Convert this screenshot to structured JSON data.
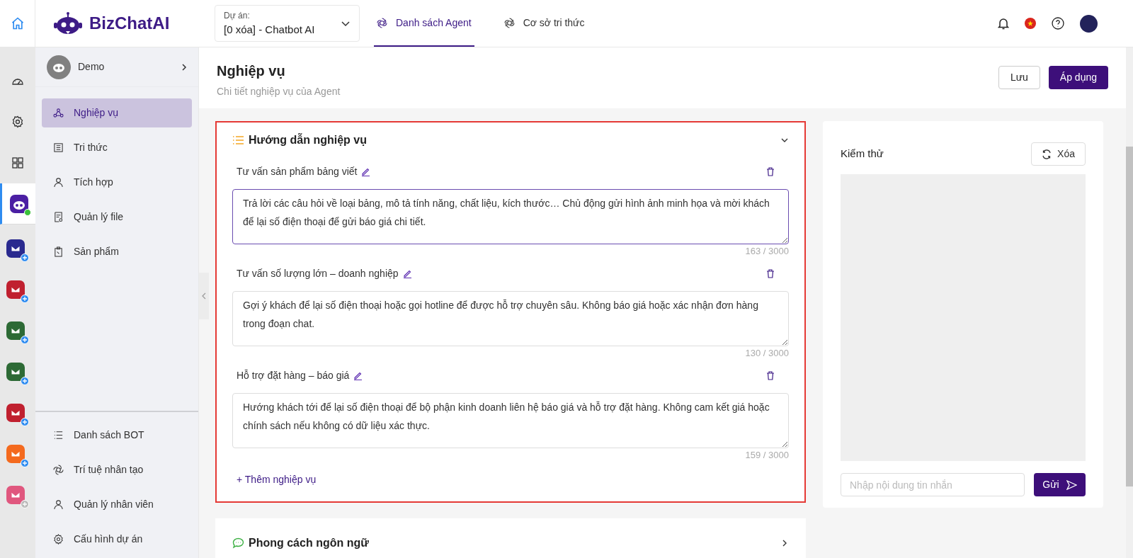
{
  "header": {
    "logo_text": "BizChatAI",
    "project": {
      "label": "Dự án:",
      "value": "[0 xóa] - Chatbot AI"
    },
    "tabs": [
      {
        "label": "Danh sách Agent",
        "selected": true
      },
      {
        "label": "Cơ sở tri thức",
        "selected": false
      }
    ]
  },
  "rail": [
    {
      "kind": "nav",
      "selected": false
    },
    {
      "kind": "nav",
      "selected": false
    },
    {
      "kind": "nav",
      "selected": false
    },
    {
      "kind": "bot",
      "selected": true,
      "online": true
    },
    {
      "kind": "app",
      "color": "#2a2a8f",
      "badge_active": true
    },
    {
      "kind": "app",
      "color": "#c0202f",
      "badge_active": true
    },
    {
      "kind": "app",
      "color": "#2d6a35",
      "badge_active": true
    },
    {
      "kind": "app",
      "color": "#2d6a35",
      "badge_active": true
    },
    {
      "kind": "app",
      "color": "#c0202f",
      "badge_active": true
    },
    {
      "kind": "app",
      "color": "#f46a1e",
      "badge_active": true
    },
    {
      "kind": "app",
      "color": "#e0577e",
      "badge_active": false
    }
  ],
  "sidebar": {
    "bot_name": "Demo",
    "items": [
      {
        "label": "Nghiệp vụ",
        "selected": true
      },
      {
        "label": "Tri thức",
        "selected": false
      },
      {
        "label": "Tích hợp",
        "selected": false
      },
      {
        "label": "Quản lý file",
        "selected": false
      },
      {
        "label": "Sản phẩm",
        "selected": false
      }
    ],
    "bottom_items": [
      "Danh sách BOT",
      "Trí tuệ nhân tạo",
      "Quản lý nhân viên",
      "Cấu hình dự án"
    ]
  },
  "page": {
    "title": "Nghiệp vụ",
    "subtitle": "Chi tiết nghiệp vụ của Agent",
    "buttons": [
      {
        "label": "Lưu",
        "kind": "secondary"
      },
      {
        "label": "Áp dụng",
        "kind": "primary"
      }
    ]
  },
  "sections": [
    {
      "title": "Hướng dẫn nghiệp vụ",
      "expanded": true,
      "highlighted": true,
      "entries": [
        {
          "title": "Tư vấn sản phẩm bảng viết",
          "text": "Trả lời các câu hỏi về loại bảng, mô tả tính năng, chất liệu, kích thước… Chủ động gửi hình ảnh minh họa và mời khách để lại số điện thoại để gửi báo giá chi tiết.",
          "count": "163 / 3000",
          "focused": true
        },
        {
          "title": "Tư vấn số lượng lớn – doanh nghiệp",
          "text": "Gợi ý khách để lại số điện thoại hoặc gọi hotline để được hỗ trợ chuyên sâu. Không báo giá hoặc xác nhận đơn hàng trong đoạn chat.",
          "count": "130 / 3000",
          "focused": false
        },
        {
          "title": "Hỗ trợ đặt hàng – báo giá",
          "text": "Hướng khách tới để lại số điện thoại để bộ phận kinh doanh liên hệ báo giá và hỗ trợ đặt hàng. Không cam kết giá hoặc chính sách nếu không có dữ liệu xác thực.",
          "count": "159 / 3000",
          "focused": false
        }
      ],
      "add_label": "+ Thêm nghiệp vụ"
    },
    {
      "title": "Phong cách ngôn ngữ",
      "expanded": false,
      "highlighted": false
    }
  ],
  "test_panel": {
    "title": "Kiểm thử",
    "clear_label": "Xóa",
    "input_placeholder": "Nhập nội dung tin nhắn",
    "send_label": "Gửi"
  }
}
